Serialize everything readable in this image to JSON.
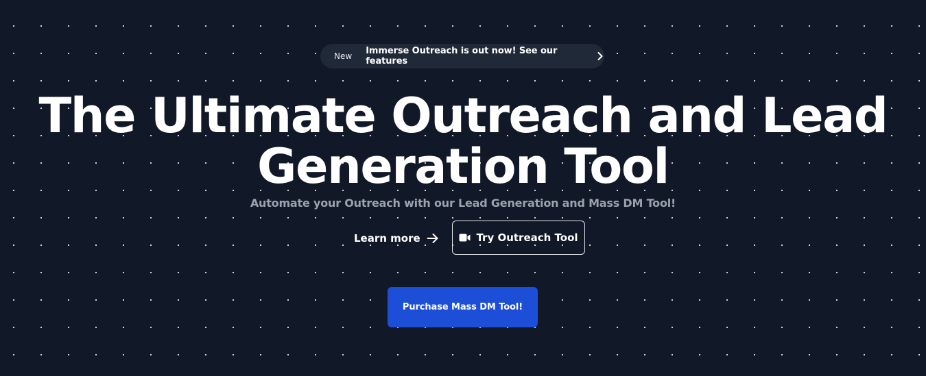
{
  "announcement": {
    "tag": "New",
    "message": "Immerse Outreach is out now! See our features",
    "icon": "chevron-right-icon"
  },
  "hero": {
    "title_line1": "The Ultimate Outreach and Lead",
    "title_line2": "Generation Tool",
    "subtitle": "Automate your Outreach with our Lead Generation and Mass DM Tool!"
  },
  "actions": {
    "learn_more_label": "Learn more",
    "learn_more_icon": "arrow-right-icon",
    "try_label": "Try Outreach Tool",
    "try_icon": "video-camera-icon",
    "purchase_label": "Purchase Mass DM Tool!"
  },
  "colors": {
    "background": "#111827",
    "pill_background": "#1f2937",
    "subtitle": "#9ca3af",
    "primary_button": "#1d4ed8",
    "text": "#ffffff"
  }
}
